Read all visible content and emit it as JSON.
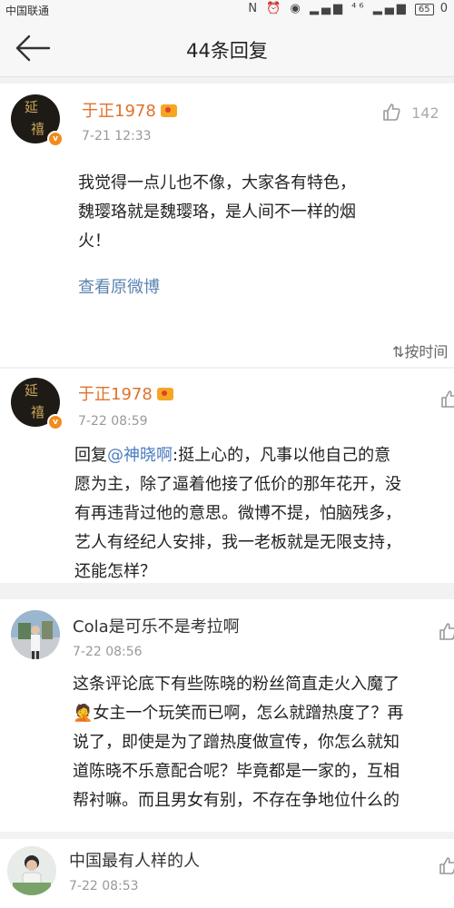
{
  "status_bar": {
    "carrier": "中国联通",
    "icons": "N ⏰ ◉ ▂▄▆ ⁴⁶ ▂▄▆",
    "battery": "65",
    "time_fragment": "0"
  },
  "header": {
    "title": "44条回复"
  },
  "main_post": {
    "username": "于正1978",
    "time": "7-21 12:33",
    "likes": "142",
    "lines": [
      "我觉得一点儿也不像，大家各有特色，",
      "魏璎珞就是魏璎珞，是人间不一样的烟",
      "火！"
    ],
    "view_original": "查看原微博",
    "sort_label": "按时间"
  },
  "replies": [
    {
      "username": "于正1978",
      "time": "7-22 08:59",
      "reply_prefix": "回复",
      "mention": "@神晓啊",
      "first_line_rest": ":挺上心的，凡事以他自己的意",
      "lines": [
        "愿为主，除了逼着他接了低价的那年花开，没",
        "有再违背过他的意思。微博不提，怕脑残多，",
        "艺人有经纪人安排，我一老板就是无限支持，",
        "还能怎样？"
      ]
    },
    {
      "username": "Cola是可乐不是考拉啊",
      "time": "7-22 08:56",
      "lines": [
        "这条评论底下有些陈晓的粉丝简直走火入魔了",
        "🤦女主一个玩笑而已啊，怎么就蹭热度了？再",
        "说了，即使是为了蹭热度做宣传，你怎么就知",
        "道陈晓不乐意配合呢？毕竟都是一家的，互相",
        "帮衬嘛。而且男女有别，不存在争地位什么的"
      ]
    },
    {
      "username": "中国最有人样的人",
      "time": "7-22 08:53"
    }
  ]
}
